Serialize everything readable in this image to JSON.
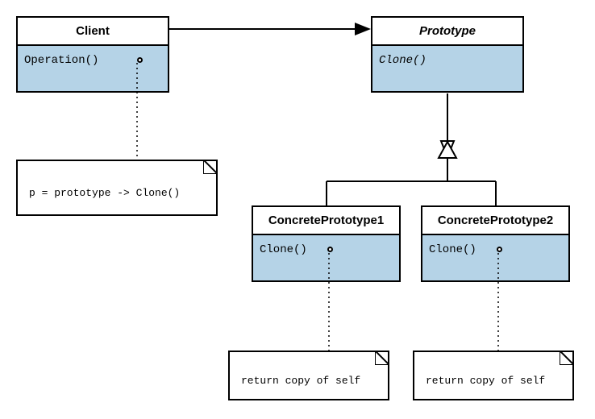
{
  "classes": {
    "client": {
      "name": "Client",
      "operation": "Operation()"
    },
    "prototype": {
      "name": "Prototype",
      "operation": "Clone()"
    },
    "concrete1": {
      "name": "ConcretePrototype1",
      "operation": "Clone()"
    },
    "concrete2": {
      "name": "ConcretePrototype2",
      "operation": "Clone()"
    }
  },
  "notes": {
    "client_note": "p = prototype -> Clone()",
    "concrete1_note": "return copy of self",
    "concrete2_note": "return copy of self"
  },
  "relations": {
    "client_to_prototype": "association-arrow",
    "prototype_to_concretes": "generalization"
  }
}
